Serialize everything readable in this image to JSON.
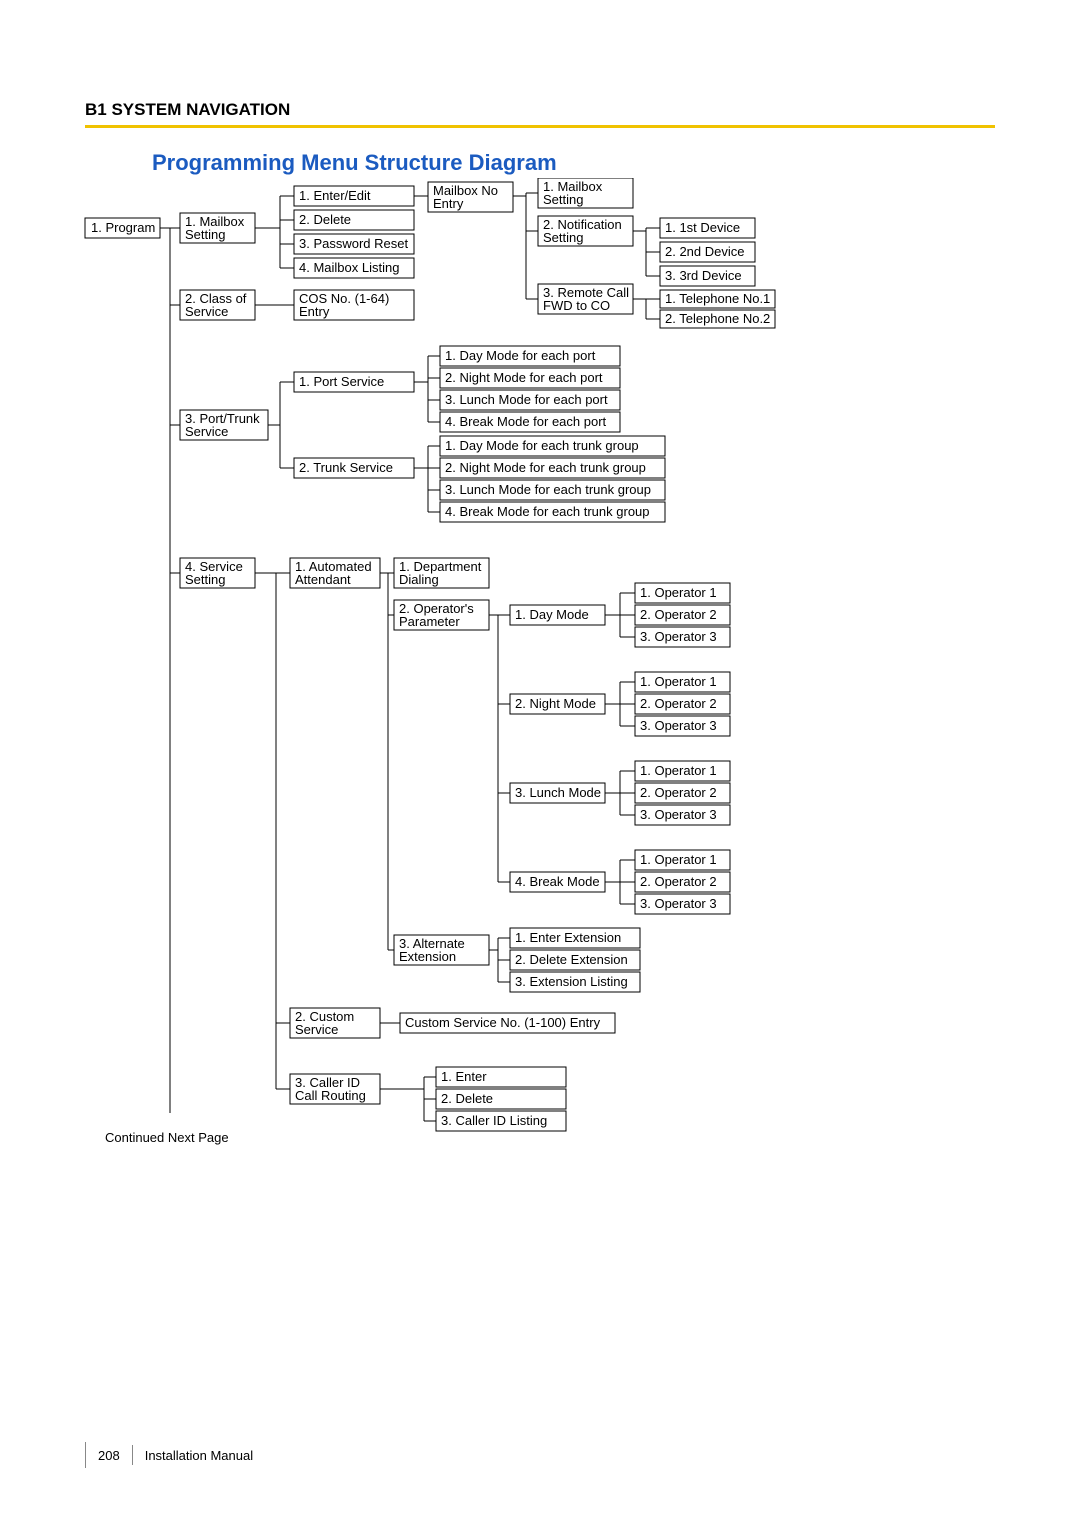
{
  "header": "B1 SYSTEM NAVIGATION",
  "title": "Programming Menu Structure Diagram",
  "continued": "Continued Next Page",
  "footer": {
    "page": "208",
    "manual": "Installation Manual"
  },
  "nodes": {
    "program": "1. Program",
    "mailboxSetting1a": "1. Mailbox",
    "mailboxSetting1b": "Setting",
    "cos_a": "2. Class of",
    "cos_b": "Service",
    "porttrunk_a": "3. Port/Trunk",
    "porttrunk_b": "Service",
    "svcset_a": "4. Service",
    "svcset_b": "Setting",
    "enterEdit": "1. Enter/Edit",
    "delete": "2. Delete",
    "pwreset": "3. Password Reset",
    "mblist": "4. Mailbox Listing",
    "mbno_a": "Mailbox No",
    "mbno_b": "Entry",
    "mbset2_a": "1. Mailbox",
    "mbset2_b": "Setting",
    "notif_a": "2. Notification",
    "notif_b": "Setting",
    "remote_a": "3. Remote Call",
    "remote_b": "FWD to CO",
    "dev1": "1. 1st Device",
    "dev2": "2. 2nd Device",
    "dev3": "3. 3rd Device",
    "tel1": "1. Telephone No.1",
    "tel2": "2. Telephone No.2",
    "cosno_a": "COS No. (1-64)",
    "cosno_b": "Entry",
    "portsvc": "1. Port Service",
    "trunksvc": "2. Trunk Service",
    "pm1": "1. Day Mode for each port",
    "pm2": "2. Night Mode for each port",
    "pm3": "3. Lunch Mode for each port",
    "pm4": "4. Break Mode for each port",
    "tm1": "1. Day Mode for each trunk group",
    "tm2": "2. Night Mode for each trunk group",
    "tm3": "3. Lunch Mode for each trunk group",
    "tm4": "4. Break Mode for each trunk group",
    "auto_a": "1. Automated",
    "auto_b": "Attendant",
    "custom_a": "2. Custom",
    "custom_b": "Service",
    "cid_a": "3. Caller ID",
    "cid_b": "Call Routing",
    "dept_a": "1. Department",
    "dept_b": "Dialing",
    "opparam_a": "2. Operator's",
    "opparam_b": "Parameter",
    "altext_a": "3. Alternate",
    "altext_b": "Extension",
    "daymode": "1. Day Mode",
    "nightmode": "2. Night Mode",
    "lunchmode": "3. Lunch Mode",
    "breakmode": "4. Break Mode",
    "op1": "1. Operator 1",
    "op2": "2. Operator 2",
    "op3": "3. Operator 3",
    "enterext": "1. Enter Extension",
    "delext": "2. Delete Extension",
    "extlist": "3. Extension Listing",
    "customno": "Custom Service No. (1-100) Entry",
    "cident": "1. Enter",
    "ciddel": "2. Delete",
    "cidlist": "3. Caller ID Listing"
  }
}
